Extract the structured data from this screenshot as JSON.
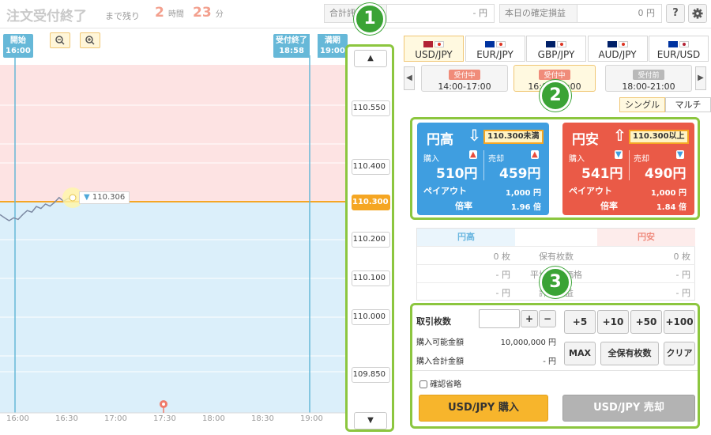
{
  "header": {
    "title": "注文受付終了",
    "remaining_label": "まで残り",
    "hours": "2",
    "hours_unit": "時間",
    "minutes": "23",
    "minutes_unit": "分",
    "unrealized_label": "合計評価損益",
    "unrealized_value": "- 円",
    "realized_label": "本日の確定損益",
    "realized_value": "0 円",
    "help_label": "?",
    "settings_icon": "gear-icon"
  },
  "chart": {
    "start_flag": "開始",
    "start_time": "16:00",
    "cutoff_flag": "受付終了",
    "cutoff_time": "18:58",
    "expiry_flag": "満期",
    "expiry_time": "19:00",
    "current_label": "110.306",
    "zoom_out_icon": "zoom-out-icon",
    "zoom_in_icon": "zoom-in-icon",
    "x_ticks": [
      "16:00",
      "16:30",
      "17:00",
      "17:30",
      "18:00",
      "18:30",
      "19:00"
    ]
  },
  "chart_data": {
    "type": "line",
    "x": [
      "16:00",
      "16:02",
      "16:04",
      "16:06",
      "16:08",
      "16:10",
      "16:12",
      "16:14",
      "16:16",
      "16:18",
      "16:20",
      "16:22",
      "16:24",
      "16:26",
      "16:28",
      "16:30",
      "16:32"
    ],
    "series": [
      {
        "values": [
          110.27,
          110.262,
          110.255,
          110.262,
          110.258,
          110.27,
          110.28,
          110.276,
          110.29,
          110.285,
          110.296,
          110.291,
          110.3,
          110.312,
          110.303,
          110.31,
          110.306
        ]
      }
    ],
    "ylim": [
      109.78,
      110.64
    ],
    "strike": 110.3,
    "colors": {
      "upper_zone": "#fde3e3",
      "lower_zone": "#dbeffa",
      "line": "#7d8aa3",
      "strike_line": "#f5a623"
    }
  },
  "ladder": {
    "up_label": "▲",
    "down_label": "▼",
    "prices": [
      "110.550",
      "110.400",
      "110.300",
      "110.200",
      "110.100",
      "110.000",
      "109.850"
    ],
    "current": "110.300"
  },
  "badges": [
    "1",
    "2",
    "3"
  ],
  "currencies": [
    "USD/JPY",
    "EUR/JPY",
    "GBP/JPY",
    "AUD/JPY",
    "EUR/USD"
  ],
  "sessions": [
    {
      "status": "受付中",
      "time": "14:00-17:00",
      "color": "#f08c7a"
    },
    {
      "status": "受付中",
      "time": "16:00-19:00",
      "color": "#f08c7a"
    },
    {
      "status": "受付前",
      "time": "18:00-21:00",
      "color": "#b9b9b9"
    }
  ],
  "session_nav": {
    "prev": "◀",
    "next": "▶"
  },
  "mode": {
    "single": "シングル",
    "multi": "マルチ"
  },
  "high_card": {
    "title": "円高",
    "condition": "110.300未満",
    "buy_label": "購入",
    "buy_price": "510円",
    "sell_label": "売却",
    "sell_price": "459円",
    "payout_label": "ペイアウト",
    "payout_value": "1,000 円",
    "ratio_label": "倍率",
    "ratio_value": "1.96 倍",
    "color": "#3f9ee0"
  },
  "low_card": {
    "title": "円安",
    "condition": "110.300以上",
    "buy_label": "購入",
    "buy_price": "541円",
    "sell_label": "売却",
    "sell_price": "490円",
    "payout_label": "ペイアウト",
    "payout_value": "1,000 円",
    "ratio_label": "倍率",
    "ratio_value": "1.84 倍",
    "color": "#ea5a47"
  },
  "position": {
    "high_header": "円高",
    "low_header": "円安",
    "rows": [
      {
        "label": "保有枚数",
        "high": "0 枚",
        "low": "0 枚"
      },
      {
        "label": "平均取得価格",
        "high": "- 円",
        "low": "- 円"
      },
      {
        "label": "評価損益",
        "high": "- 円",
        "low": "- 円"
      }
    ]
  },
  "order": {
    "qty_label": "取引枚数",
    "qty_value": "",
    "plus": "+",
    "minus": "−",
    "avail_label": "購入可能金額",
    "avail_value": "10,000,000 円",
    "total_label": "購入合計金額",
    "total_value": "- 円",
    "quick": [
      "+5",
      "+10",
      "+50",
      "+100"
    ],
    "max": "MAX",
    "all": "全保有枚数",
    "clear": "クリア",
    "confirm_skip": "確認省略",
    "buy_button": "USD/JPY 購入",
    "sell_button": "USD/JPY 売却"
  }
}
